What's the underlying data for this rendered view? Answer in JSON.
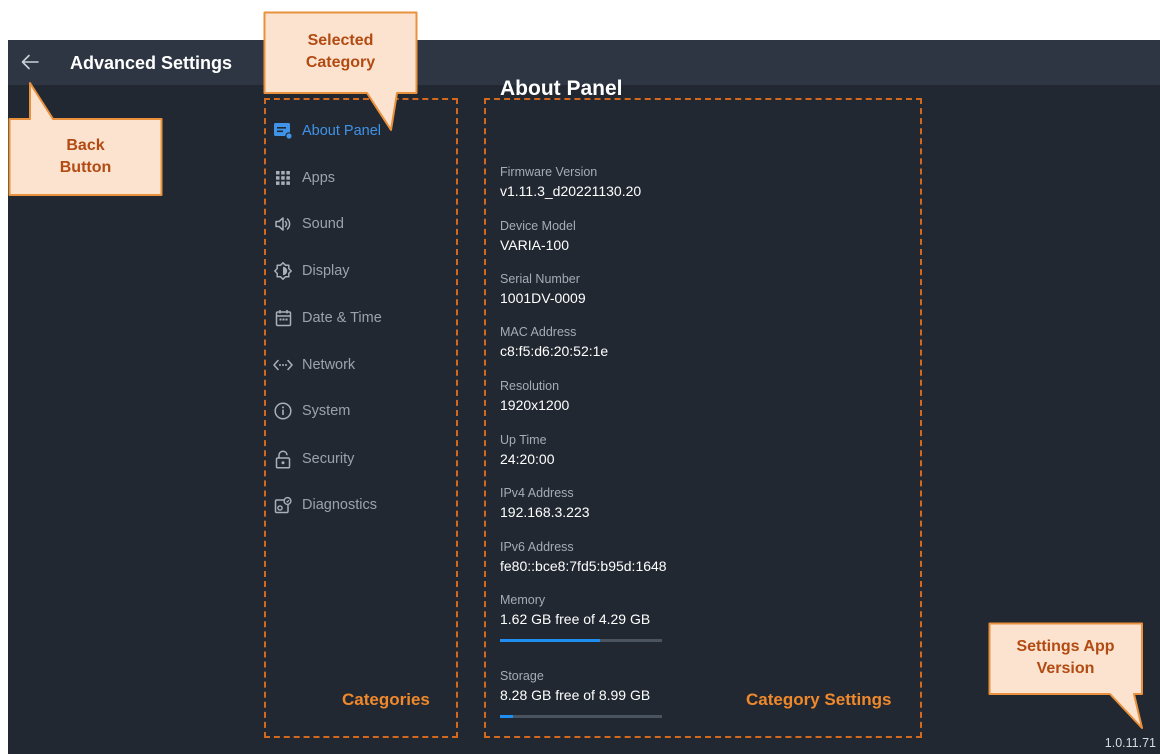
{
  "header": {
    "title": "Advanced Settings",
    "back_icon": "arrow-left-icon"
  },
  "categories": [
    {
      "id": "about",
      "label": "About Panel",
      "icon": "about-panel-icon",
      "active": true
    },
    {
      "id": "apps",
      "label": "Apps",
      "icon": "apps-grid-icon",
      "active": false
    },
    {
      "id": "sound",
      "label": "Sound",
      "icon": "speaker-icon",
      "active": false
    },
    {
      "id": "display",
      "label": "Display",
      "icon": "brightness-icon",
      "active": false
    },
    {
      "id": "datetime",
      "label": "Date & Time",
      "icon": "calendar-icon",
      "active": false
    },
    {
      "id": "network",
      "label": "Network",
      "icon": "network-icon",
      "active": false
    },
    {
      "id": "system",
      "label": "System",
      "icon": "info-icon",
      "active": false
    },
    {
      "id": "security",
      "label": "Security",
      "icon": "lock-icon",
      "active": false
    },
    {
      "id": "diagnostics",
      "label": "Diagnostics",
      "icon": "diagnostics-icon",
      "active": false
    }
  ],
  "panel": {
    "title": "About Panel",
    "fields": [
      {
        "label": "Firmware Version",
        "value": "v1.11.3_d20221130.20"
      },
      {
        "label": "Device Model",
        "value": "VARIA-100"
      },
      {
        "label": "Serial Number",
        "value": "1001DV-0009"
      },
      {
        "label": "MAC Address",
        "value": "c8:f5:d6:20:52:1e"
      },
      {
        "label": "Resolution",
        "value": "1920x1200"
      },
      {
        "label": "Up Time",
        "value": "24:20:00"
      },
      {
        "label": "IPv4 Address",
        "value": "192.168.3.223"
      },
      {
        "label": "IPv6 Address",
        "value": "fe80::bce8:7fd5:b95d:1648"
      }
    ],
    "memory": {
      "label": "Memory",
      "value": "1.62 GB free of 4.29 GB",
      "used_percent": 62
    },
    "storage": {
      "label": "Storage",
      "value": "8.28 GB free of 8.99 GB",
      "used_percent": 8
    }
  },
  "app_version": "1.0.11.71",
  "annotations": {
    "selected_category": "Selected Category",
    "back_button": "Back Button",
    "settings_app_version": "Settings App Version",
    "categories": "Categories",
    "category_settings": "Category Settings"
  },
  "colors": {
    "background": "#222831",
    "topbar": "#2d3642",
    "accent": "#3f93e8",
    "progress": "#1f8ef1",
    "annotation": "#f0882c",
    "callout_fill": "#fbe3cf"
  }
}
